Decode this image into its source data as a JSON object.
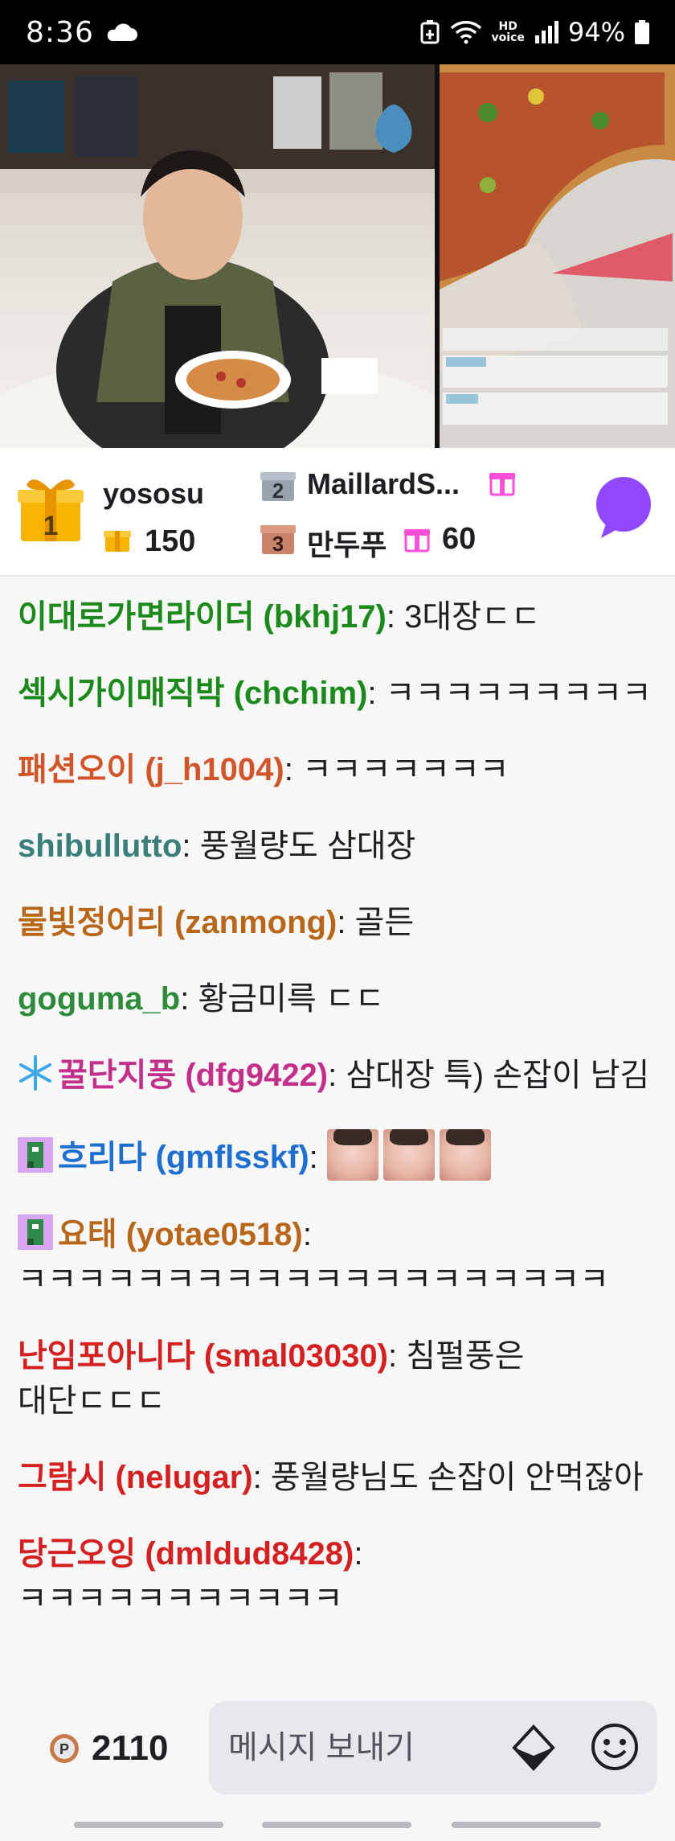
{
  "status_bar": {
    "time": "8:36",
    "hd_top": "HD",
    "hd_bottom": "voice",
    "battery": "94%"
  },
  "top_gifters": {
    "first": {
      "rank": "1",
      "name": "yososu",
      "count": "150"
    },
    "second": {
      "rank": "2",
      "name": "MaillardS..."
    },
    "third": {
      "rank": "3",
      "name": "만두푸",
      "count": "60"
    }
  },
  "chat": [
    {
      "user": "이대로가면라이더 (bkhj17)",
      "color": "#1b8a1b",
      "text": "3대장ㄷㄷ"
    },
    {
      "user": "섹시가이매직박 (chchim)",
      "color": "#1b8a1b",
      "text": "ㅋㅋㅋㅋㅋㅋㅋㅋㅋ"
    },
    {
      "user": "패션오이 (j_h1004)",
      "color": "#d2552a",
      "text": "ㅋㅋㅋㅋㅋㅋㅋ"
    },
    {
      "user": "shibullutto",
      "color": "#3a7e7a",
      "text": "풍월량도 삼대장"
    },
    {
      "user": "물빛정어리 (zanmong)",
      "color": "#b8671a",
      "text": "골든"
    },
    {
      "user": "goguma_b",
      "color": "#2e8b3c",
      "text": "황금미륵 ㄷㄷ"
    },
    {
      "user": "꿀단지풍 (dfg9422)",
      "color": "#c2308a",
      "text": "삼대장 특) 손잡이 남김",
      "badge": "snowflake"
    },
    {
      "user": "흐리다 (gmflsskf)",
      "color": "#1e6fd0",
      "text": "",
      "badge": "pixel",
      "emotes": 3
    },
    {
      "user": "요태 (yotae0518)",
      "color": "#b8671a",
      "text": "ㅋㅋㅋㅋㅋㅋㅋㅋㅋㅋㅋㅋㅋㅋㅋㅋㅋㅋㅋㅋ",
      "badge": "pixel"
    },
    {
      "user": "난임포아니다 (smal03030)",
      "color": "#d42020",
      "text": "침펄풍은 대단ㄷㄷㄷ"
    },
    {
      "user": "그람시 (nelugar)",
      "color": "#d42020",
      "text": "풍월량님도 손잡이 안먹잖아"
    },
    {
      "user": "당근오잉 (dmldud8428)",
      "color": "#d42020",
      "text": "ㅋㅋㅋㅋㅋㅋㅋㅋㅋㅋㅋ"
    }
  ],
  "bottom": {
    "points": "2110",
    "placeholder": "메시지 보내기"
  },
  "colors": {
    "accent": "#9147ff",
    "gift_gold": "#f4b400",
    "gift_pink": "#ff4fd8"
  }
}
